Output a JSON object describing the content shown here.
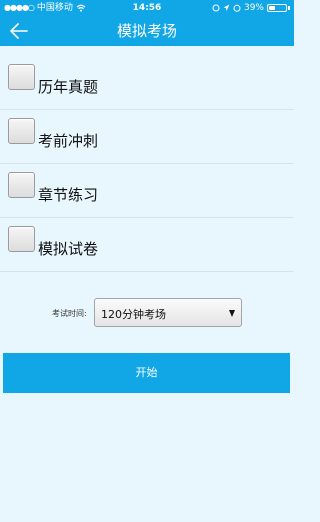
{
  "status_bar": {
    "carrier": "中国移动",
    "time": "14:56",
    "battery": "39%",
    "battery_level": 0.39
  },
  "header": {
    "title": "模拟考场",
    "back_icon": "arrow-left-icon"
  },
  "options": [
    {
      "label": "历年真题",
      "checked": false
    },
    {
      "label": "考前冲刺",
      "checked": false
    },
    {
      "label": "章节练习",
      "checked": false
    },
    {
      "label": "模拟试卷",
      "checked": false
    }
  ],
  "exam_time": {
    "label": "考试时间:",
    "selected": "120分钟考场"
  },
  "start_button": {
    "label": "开始"
  },
  "colors": {
    "primary": "#11a6e6",
    "background": "#e8f7fd"
  }
}
